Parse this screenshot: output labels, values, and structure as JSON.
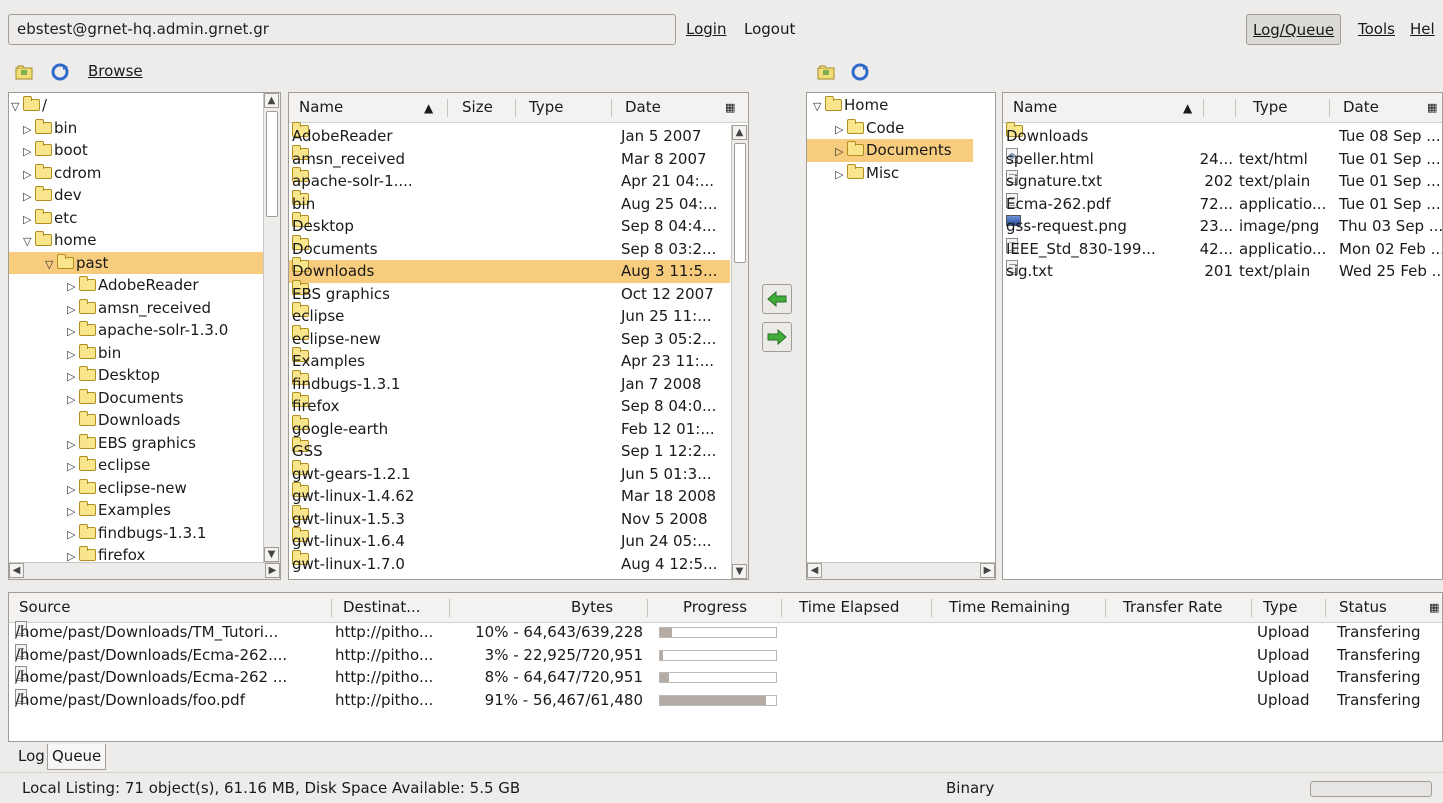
{
  "connection": {
    "account": "ebstest@grnet-hq.admin.grnet.gr",
    "login": "Login",
    "logout": "Logout"
  },
  "menu": {
    "logqueue": "Log/Queue",
    "tools": "Tools",
    "help": "Hel"
  },
  "local": {
    "browse_label": "Browse",
    "tree": [
      {
        "label": "/",
        "level": 0,
        "open": true
      },
      {
        "label": "bin",
        "level": 1
      },
      {
        "label": "boot",
        "level": 1
      },
      {
        "label": "cdrom",
        "level": 1
      },
      {
        "label": "dev",
        "level": 1
      },
      {
        "label": "etc",
        "level": 1
      },
      {
        "label": "home",
        "level": 1,
        "open": true
      },
      {
        "label": "past",
        "level": 2,
        "open": true,
        "selected": true
      },
      {
        "label": "AdobeReader",
        "level": 3
      },
      {
        "label": "amsn_received",
        "level": 3
      },
      {
        "label": "apache-solr-1.3.0",
        "level": 3
      },
      {
        "label": "bin",
        "level": 3
      },
      {
        "label": "Desktop",
        "level": 3
      },
      {
        "label": "Documents",
        "level": 3
      },
      {
        "label": "Downloads",
        "level": 3,
        "leaf": true
      },
      {
        "label": "EBS graphics",
        "level": 3
      },
      {
        "label": "eclipse",
        "level": 3
      },
      {
        "label": "eclipse-new",
        "level": 3
      },
      {
        "label": "Examples",
        "level": 3
      },
      {
        "label": "findbugs-1.3.1",
        "level": 3
      },
      {
        "label": "firefox",
        "level": 3
      }
    ],
    "headers": {
      "name": "Name",
      "size": "Size",
      "type": "Type",
      "date": "Date"
    },
    "files": [
      {
        "name": "AdobeReader",
        "date": "Jan 5 2007"
      },
      {
        "name": "amsn_received",
        "date": "Mar 8 2007"
      },
      {
        "name": "apache-solr-1....",
        "date": "Apr 21 04:..."
      },
      {
        "name": "bin",
        "date": "Aug 25 04:..."
      },
      {
        "name": "Desktop",
        "date": "Sep 8 04:4..."
      },
      {
        "name": "Documents",
        "date": "Sep 8 03:2..."
      },
      {
        "name": "Downloads",
        "date": "Aug 3 11:5...",
        "selected": true
      },
      {
        "name": "EBS graphics",
        "date": "Oct 12 2007"
      },
      {
        "name": "eclipse",
        "date": "Jun 25 11:..."
      },
      {
        "name": "eclipse-new",
        "date": "Sep 3 05:2..."
      },
      {
        "name": "Examples",
        "date": "Apr 23 11:..."
      },
      {
        "name": "findbugs-1.3.1",
        "date": "Jan 7 2008"
      },
      {
        "name": "firefox",
        "date": "Sep 8 04:0..."
      },
      {
        "name": "google-earth",
        "date": "Feb 12 01:..."
      },
      {
        "name": "GSS",
        "date": "Sep 1 12:2..."
      },
      {
        "name": "gwt-gears-1.2.1",
        "date": "Jun 5 01:3..."
      },
      {
        "name": "gwt-linux-1.4.62",
        "date": "Mar 18 2008"
      },
      {
        "name": "gwt-linux-1.5.3",
        "date": "Nov 5 2008"
      },
      {
        "name": "gwt-linux-1.6.4",
        "date": "Jun 24 05:..."
      },
      {
        "name": "gwt-linux-1.7.0",
        "date": "Aug 4 12:5..."
      }
    ]
  },
  "remote": {
    "tree": [
      {
        "label": "Home",
        "level": 0,
        "open": true
      },
      {
        "label": "Code",
        "level": 1
      },
      {
        "label": "Documents",
        "level": 1,
        "selected": true
      },
      {
        "label": "Misc",
        "level": 1
      }
    ],
    "headers": {
      "name": "Name",
      "type": "Type",
      "date": "Date"
    },
    "files": [
      {
        "name": "Downloads",
        "icon": "folder",
        "size": "",
        "type": "",
        "date": "Tue 08 Sep ..."
      },
      {
        "name": "speller.html",
        "icon": "html",
        "size": "24...",
        "type": "text/html",
        "date": "Tue 01 Sep ..."
      },
      {
        "name": "signature.txt",
        "icon": "file",
        "size": "202",
        "type": "text/plain",
        "date": "Tue 01 Sep ..."
      },
      {
        "name": "Ecma-262.pdf",
        "icon": "file",
        "size": "72...",
        "type": "applicatio...",
        "date": "Tue 01 Sep ..."
      },
      {
        "name": "gss-request.png",
        "icon": "image",
        "size": "23...",
        "type": "image/png",
        "date": "Thu 03 Sep ..."
      },
      {
        "name": "IEEE_Std_830-199...",
        "icon": "file",
        "size": "42...",
        "type": "applicatio...",
        "date": "Mon 02 Feb ..."
      },
      {
        "name": "sig.txt",
        "icon": "file",
        "size": "201",
        "type": "text/plain",
        "date": "Wed 25 Feb ..."
      }
    ]
  },
  "queue": {
    "headers": {
      "source": "Source",
      "destination": "Destinat...",
      "bytes": "Bytes",
      "progress": "Progress",
      "elapsed": "Time Elapsed",
      "remaining": "Time Remaining",
      "rate": "Transfer Rate",
      "type": "Type",
      "status": "Status"
    },
    "rows": [
      {
        "source": "/home/past/Downloads/TM_Tutori...",
        "destination": "http://pitho...",
        "bytes": "10% - 64,643/639,228",
        "progress": 0.1,
        "type": "Upload",
        "status": "Transfering"
      },
      {
        "source": "/home/past/Downloads/Ecma-262....",
        "destination": "http://pitho...",
        "bytes": "3% - 22,925/720,951",
        "progress": 0.03,
        "type": "Upload",
        "status": "Transfering"
      },
      {
        "source": "/home/past/Downloads/Ecma-262 ...",
        "destination": "http://pitho...",
        "bytes": "8% - 64,647/720,951",
        "progress": 0.08,
        "type": "Upload",
        "status": "Transfering"
      },
      {
        "source": "/home/past/Downloads/foo.pdf",
        "destination": "http://pitho...",
        "bytes": "91% - 56,467/61,480",
        "progress": 0.91,
        "type": "Upload",
        "status": "Transfering"
      }
    ],
    "tabs": [
      "Log",
      "Queue"
    ]
  },
  "status": {
    "listing": "Local Listing: 71 object(s), 61.16 MB, Disk Space Available: 5.5 GB",
    "mode": "Binary"
  },
  "colors": {
    "selection": "#f7cc7d",
    "background": "#edeceb",
    "progress_fill": "#b4aca4"
  }
}
